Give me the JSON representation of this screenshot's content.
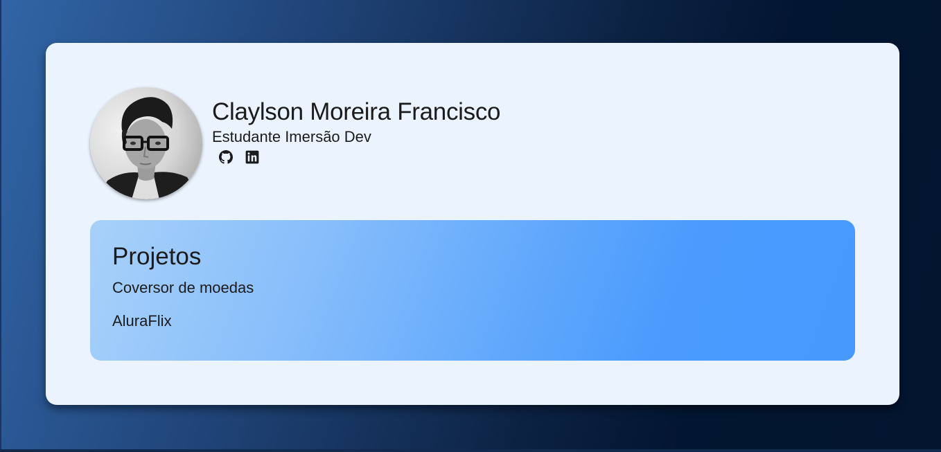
{
  "profile": {
    "name": "Claylson Moreira Francisco",
    "role": "Estudante Imersão Dev",
    "avatar_icon": "person-photo",
    "social": [
      {
        "icon": "github-icon"
      },
      {
        "icon": "linkedin-icon"
      }
    ]
  },
  "projects": {
    "title": "Projetos",
    "items": [
      {
        "label": "Coversor de moedas"
      },
      {
        "label": "AluraFlix"
      }
    ]
  },
  "colors": {
    "card_background": "#ebf3fe",
    "text": "#1b1b1d",
    "projects_gradient_start": "#a8d1f9",
    "projects_gradient_end": "#4799fe",
    "page_gradient_start": "#3165a6",
    "page_gradient_end": "#03152f"
  }
}
